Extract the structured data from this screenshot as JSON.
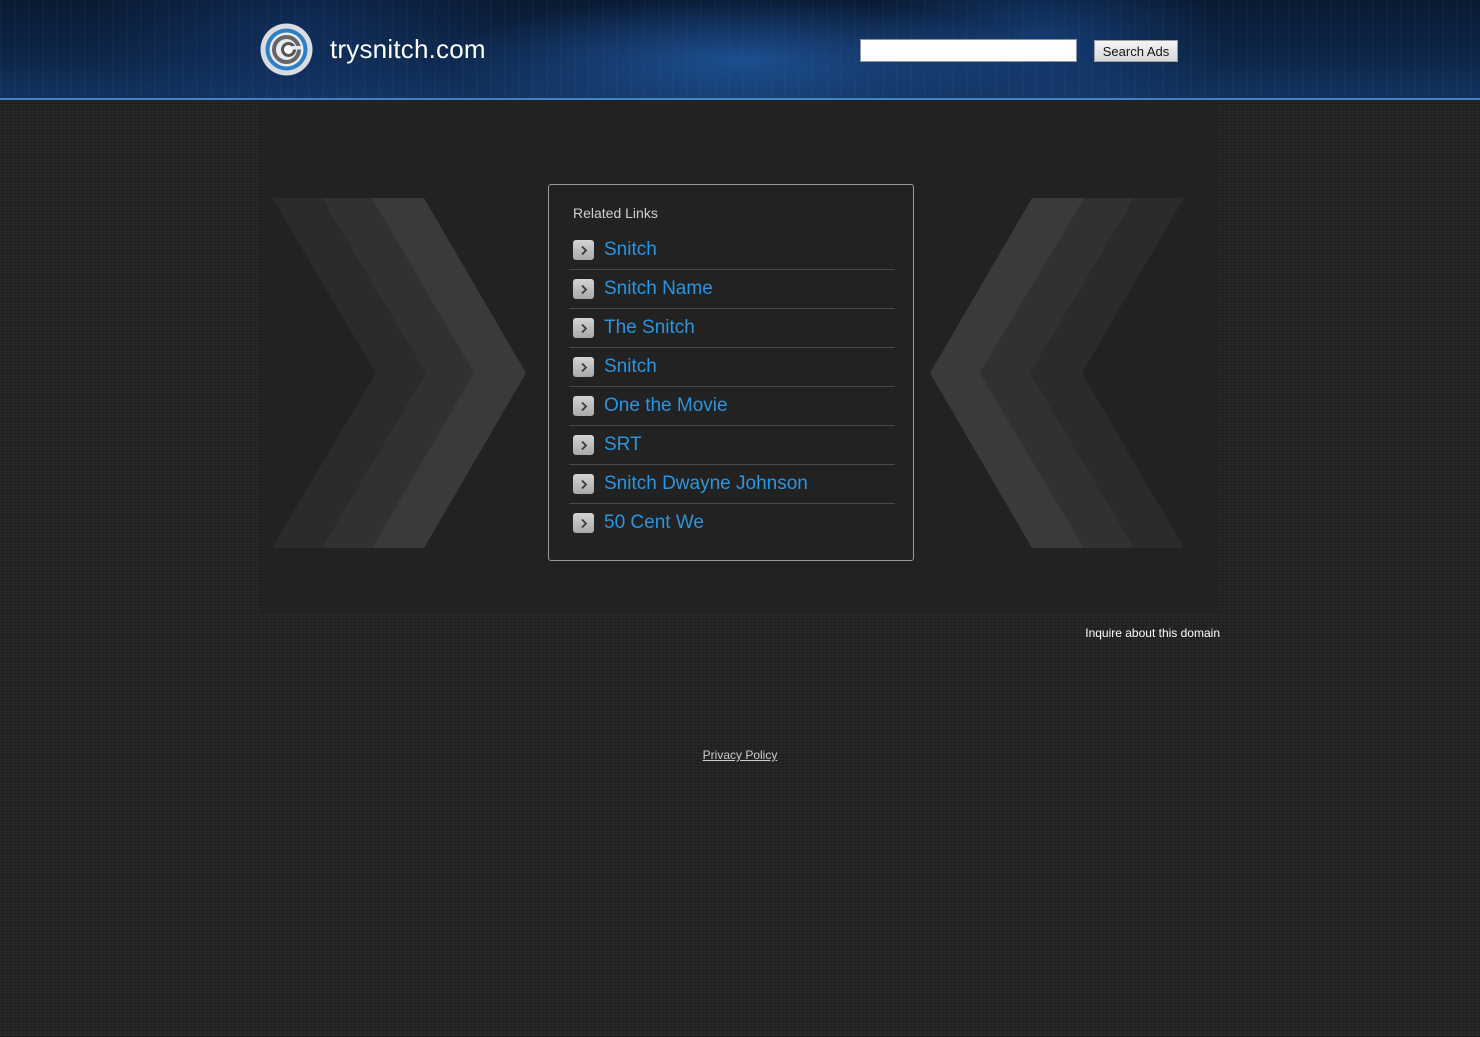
{
  "header": {
    "site_title": "trysnitch.com",
    "logo_icon": "circular-logo-icon",
    "search": {
      "placeholder": "",
      "value": "",
      "button_label": "Search Ads"
    }
  },
  "related_links": {
    "heading": "Related Links",
    "items": [
      {
        "label": "Snitch"
      },
      {
        "label": "Snitch Name"
      },
      {
        "label": "The Snitch"
      },
      {
        "label": "Snitch"
      },
      {
        "label": "One the Movie"
      },
      {
        "label": "SRT"
      },
      {
        "label": "Snitch Dwayne Johnson"
      },
      {
        "label": "50 Cent We"
      }
    ],
    "item_icon": "chevron-right-icon"
  },
  "footer": {
    "inquire_label": "Inquire about this domain",
    "privacy_label": "Privacy Policy"
  },
  "colors": {
    "link": "#2a95e0",
    "header_border": "#3e86c8",
    "background": "#252525",
    "panel": "#222222"
  }
}
